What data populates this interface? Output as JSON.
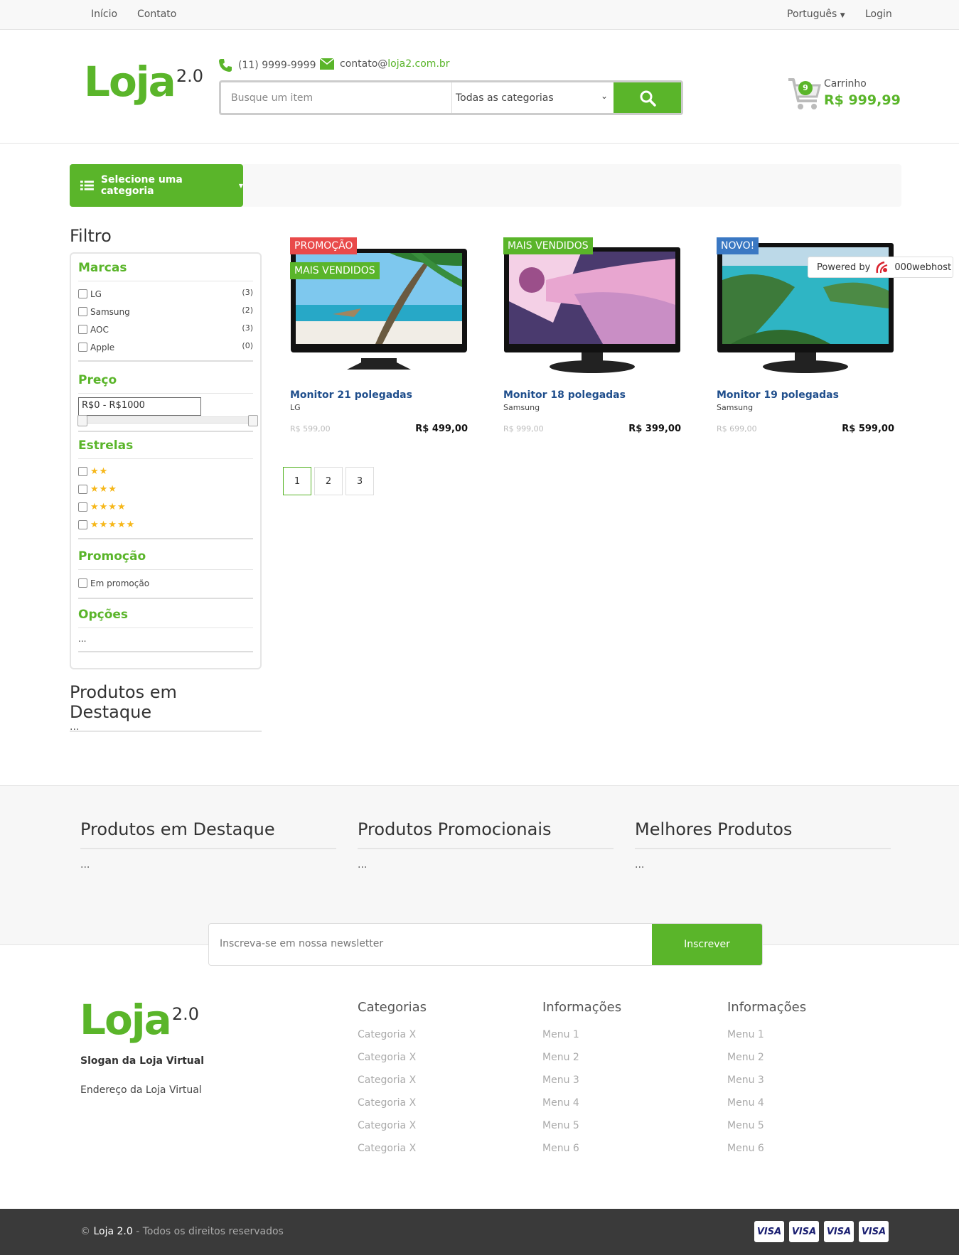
{
  "topbar": {
    "home": "Início",
    "contact": "Contato",
    "language": "Português",
    "login": "Login"
  },
  "header": {
    "logo_main": "Loja",
    "logo_version": "2.0",
    "phone": "(11) 9999-9999",
    "email_prefix": "contato@",
    "email_domain": "loja2.com.br",
    "search_placeholder": "Busque um item",
    "category_select": "Todas as categorias",
    "cart_count": "9",
    "cart_label": "Carrinho",
    "cart_total": "R$ 999,99"
  },
  "category_button": "Selecione uma categoria",
  "filter": {
    "title": "Filtro",
    "brands_title": "Marcas",
    "brands": [
      {
        "name": "LG",
        "count": "(3)"
      },
      {
        "name": "Samsung",
        "count": "(2)"
      },
      {
        "name": "AOC",
        "count": "(3)"
      },
      {
        "name": "Apple",
        "count": "(0)"
      }
    ],
    "price_title": "Preço",
    "price_range": "R$0 - R$1000",
    "stars_title": "Estrelas",
    "stars": [
      2,
      3,
      4,
      5
    ],
    "promo_title": "Promoção",
    "promo_label": "Em promoção",
    "options_title": "Opções",
    "options_text": "..."
  },
  "featured": {
    "title": "Produtos em Destaque",
    "text": "..."
  },
  "products": [
    {
      "name": "Monitor 21 polegadas",
      "brand": "LG",
      "old_price": "R$ 599,00",
      "price": "R$ 499,00",
      "tags": [
        "PROMOÇÃO",
        "MAIS VENDIDOS"
      ]
    },
    {
      "name": "Monitor 18 polegadas",
      "brand": "Samsung",
      "old_price": "R$ 999,00",
      "price": "R$ 399,00",
      "tags": [
        "MAIS VENDIDOS"
      ]
    },
    {
      "name": "Monitor 19 polegadas",
      "brand": "Samsung",
      "old_price": "R$ 699,00",
      "price": "R$ 599,00",
      "tags": [
        "NOVO!"
      ]
    }
  ],
  "pagination": [
    "1",
    "2",
    "3"
  ],
  "footer_sections": [
    {
      "title": "Produtos em Destaque",
      "text": "..."
    },
    {
      "title": "Produtos Promocionais",
      "text": "..."
    },
    {
      "title": "Melhores Produtos",
      "text": "..."
    }
  ],
  "newsletter": {
    "placeholder": "Inscreva-se em nossa newsletter",
    "button": "Inscrever"
  },
  "footer": {
    "slogan": "Slogan da Loja Virtual",
    "address": "Endereço da Loja Virtual",
    "categories_title": "Categorias",
    "categories": [
      "Categoria X",
      "Categoria X",
      "Categoria X",
      "Categoria X",
      "Categoria X",
      "Categoria X"
    ],
    "info1_title": "Informações",
    "info1": [
      "Menu 1",
      "Menu 2",
      "Menu 3",
      "Menu 4",
      "Menu 5",
      "Menu 6"
    ],
    "info2_title": "Informações",
    "info2": [
      "Menu 1",
      "Menu 2",
      "Menu 3",
      "Menu 4",
      "Menu 5",
      "Menu 6"
    ]
  },
  "bottom": {
    "copy_symbol": "©",
    "brand": "Loja 2.0",
    "rights": "- Todos os direitos reservados",
    "card_label": "VISA"
  },
  "powered": {
    "label": "Powered by",
    "brand": "000webhost"
  },
  "colors": {
    "accent": "#5ab52a",
    "promo": "#e94a4a",
    "new": "#3a78c3",
    "link": "#1f4e8c"
  }
}
